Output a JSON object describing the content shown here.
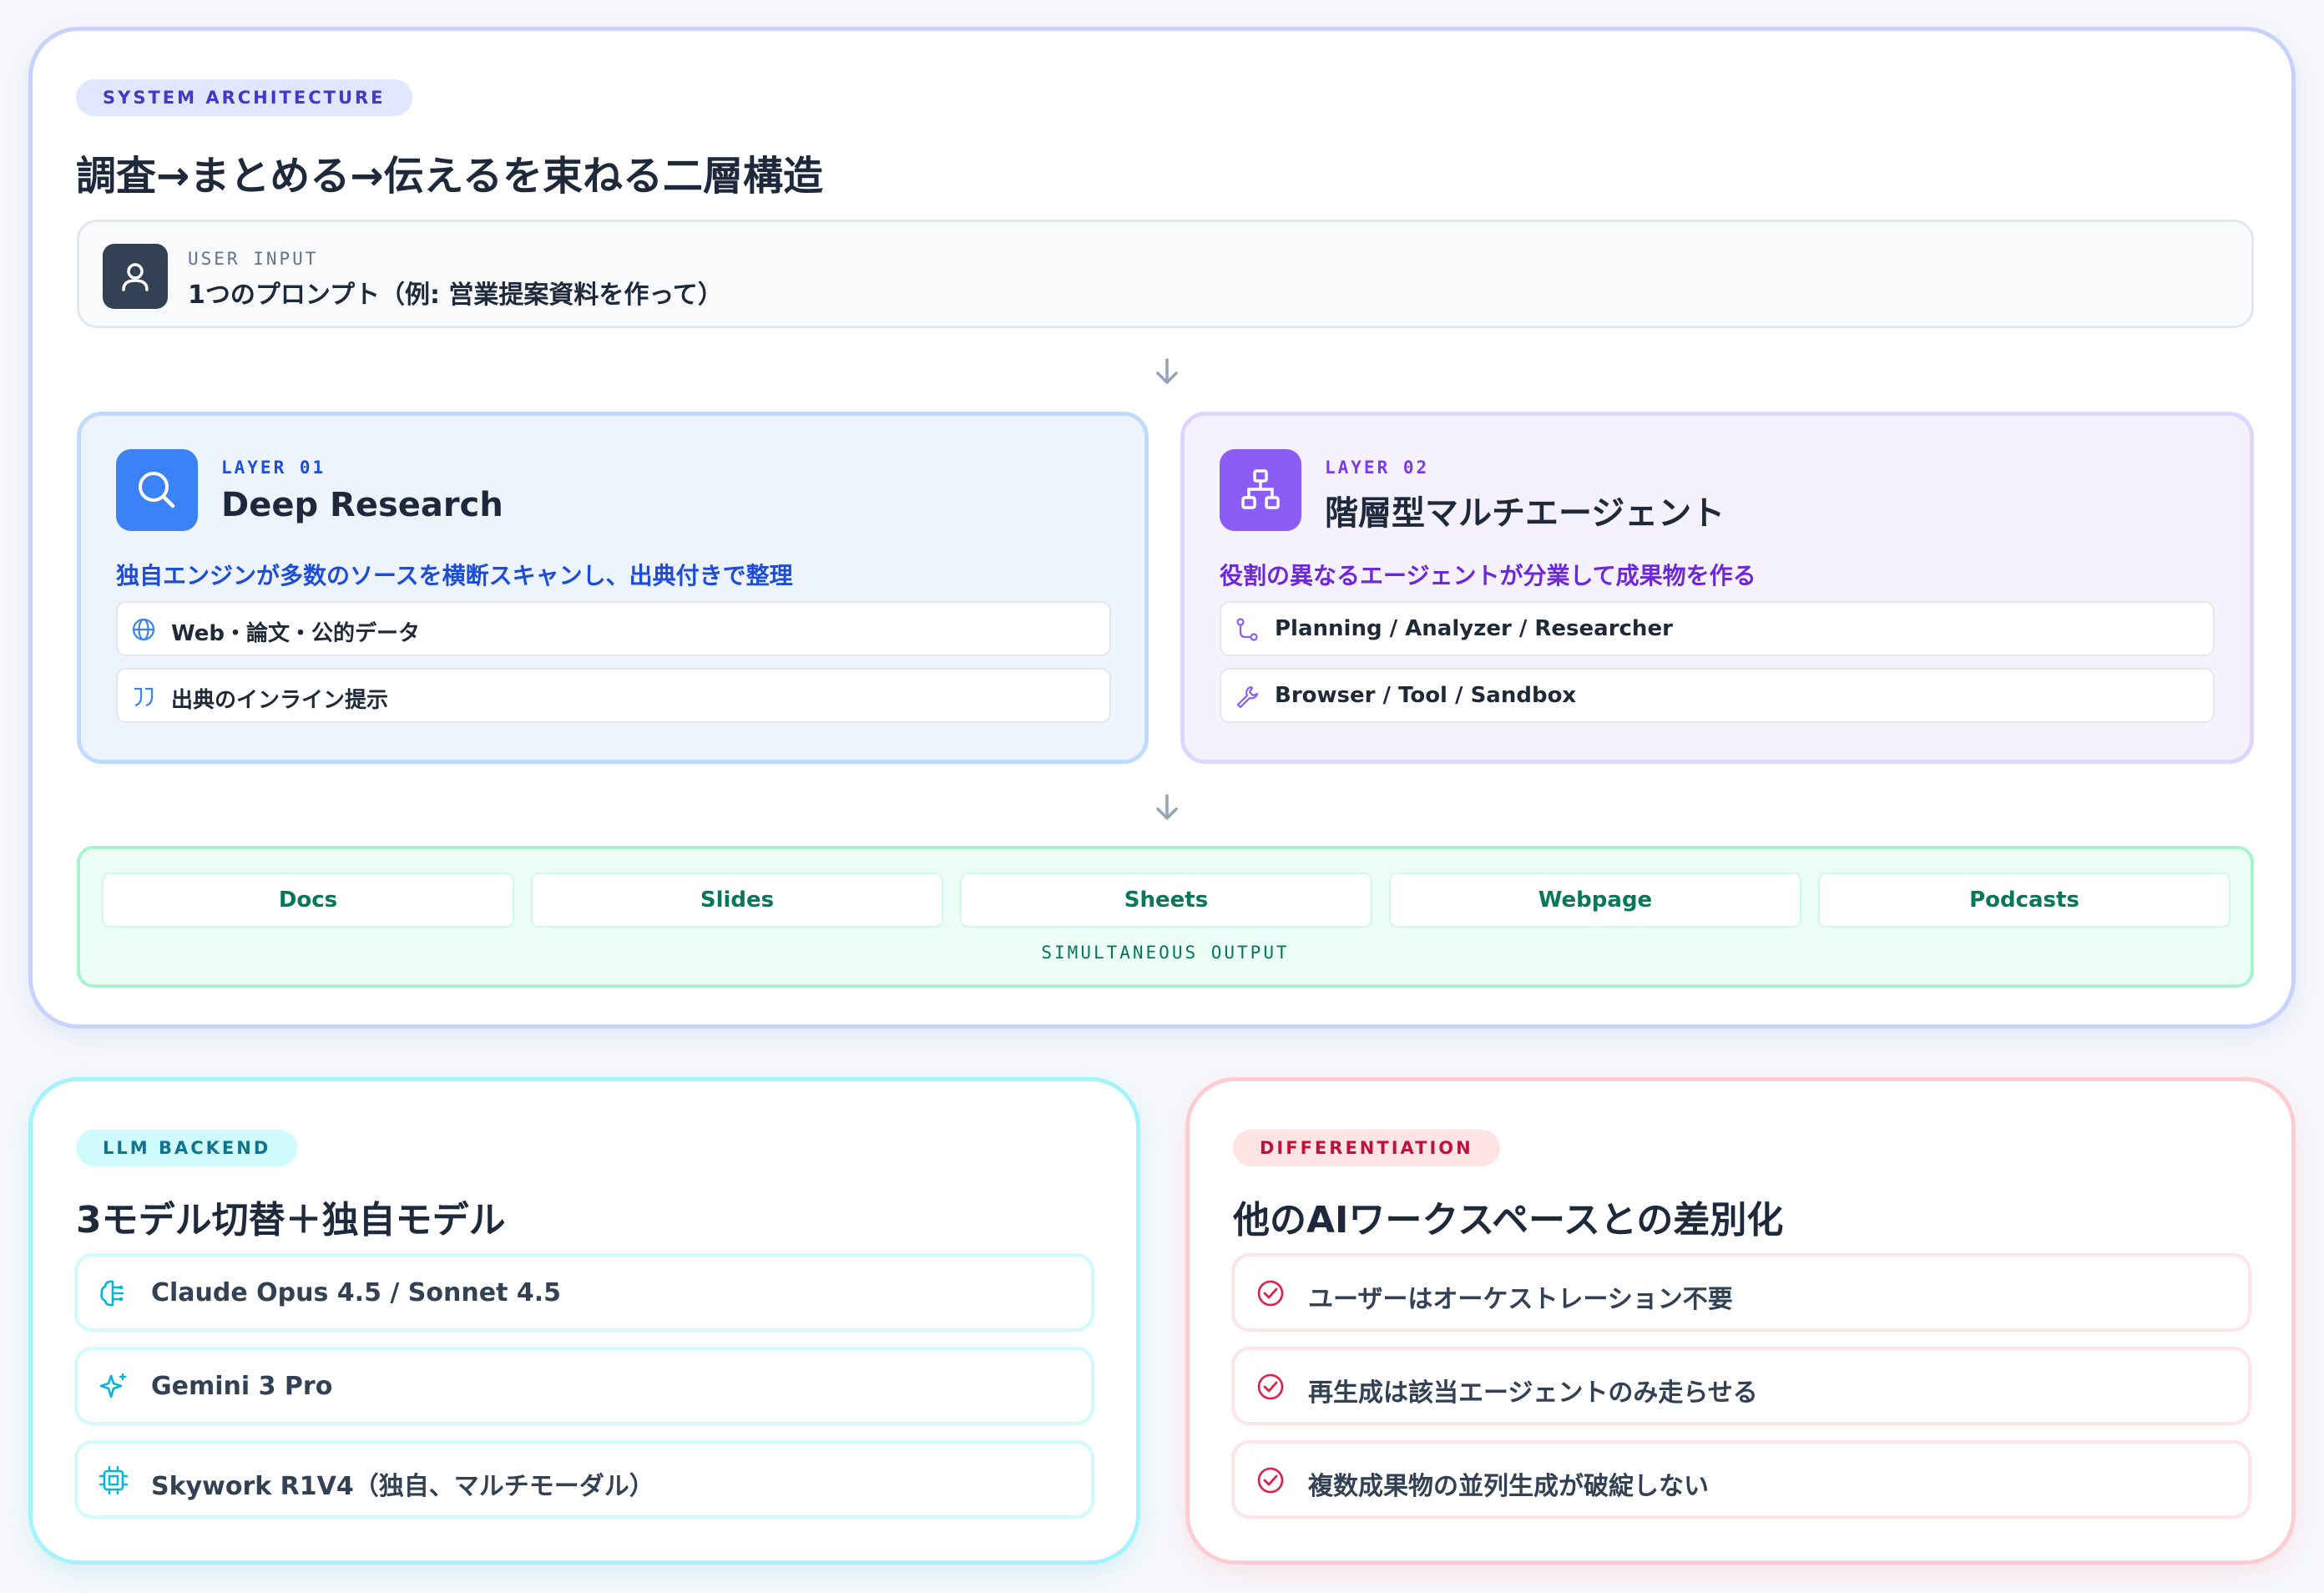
{
  "architecture": {
    "badge": "SYSTEM ARCHITECTURE",
    "title": "調査→まとめる→伝えるを束ねる二層構造",
    "user_input": {
      "label": "USER INPUT",
      "text": "1つのプロンプト（例: 営業提案資料を作って）",
      "icon": "user-icon"
    },
    "layer1": {
      "label": "LAYER 01",
      "title": "Deep Research",
      "subtitle": "独自エンジンが多数のソースを横断スキャンし、出典付きで整理",
      "icon": "search-icon",
      "items": [
        {
          "icon": "globe-icon",
          "text": "Web・論文・公的データ"
        },
        {
          "icon": "quote-icon",
          "text": "出典のインライン提示"
        }
      ]
    },
    "layer2": {
      "label": "LAYER 02",
      "title": "階層型マルチエージェント",
      "subtitle": "役割の異なるエージェントが分業して成果物を作る",
      "icon": "hierarchy-icon",
      "items": [
        {
          "icon": "route-icon",
          "text": "Planning / Analyzer / Researcher"
        },
        {
          "icon": "wrench-icon",
          "text": "Browser / Tool / Sandbox"
        }
      ]
    },
    "outputs": [
      "Docs",
      "Slides",
      "Sheets",
      "Webpage",
      "Podcasts"
    ],
    "outputs_label": "SIMULTANEOUS OUTPUT"
  },
  "llm": {
    "badge": "LLM BACKEND",
    "title": "3モデル切替＋独自モデル",
    "items": [
      {
        "icon": "brain-icon",
        "text": "Claude Opus 4.5 / Sonnet 4.5"
      },
      {
        "icon": "sparkles-icon",
        "text": "Gemini 3 Pro"
      },
      {
        "icon": "chip-icon",
        "text": "Skywork R1V4（独自、マルチモーダル）"
      }
    ]
  },
  "differentiation": {
    "badge": "DIFFERENTIATION",
    "title": "他のAIワークスペースとの差別化",
    "items": [
      {
        "icon": "check-circle-icon",
        "text": "ユーザーはオーケストレーション不要"
      },
      {
        "icon": "check-circle-icon",
        "text": "再生成は該当エージェントのみ走らせる"
      },
      {
        "icon": "check-circle-icon",
        "text": "複数成果物の並列生成が破綻しない"
      }
    ]
  },
  "colors": {
    "indigo": "#4338ca",
    "blue": "#3b82f6",
    "violet": "#8b5cf6",
    "emerald": "#047857",
    "cyan": "#06b6d4",
    "rose": "#e11d48"
  }
}
